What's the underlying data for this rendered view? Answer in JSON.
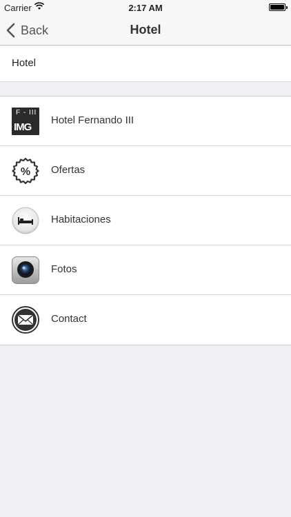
{
  "status_bar": {
    "carrier": "Carrier",
    "time": "2:17 AM"
  },
  "nav": {
    "back_label": "Back",
    "title": "Hotel"
  },
  "header_row": {
    "text": "Hotel"
  },
  "menu": {
    "items": [
      {
        "label": "Hotel Fernando III",
        "icon": "hotel-logo-icon"
      },
      {
        "label": "Ofertas",
        "icon": "percent-badge-icon"
      },
      {
        "label": "Habitaciones",
        "icon": "bed-icon"
      },
      {
        "label": "Fotos",
        "icon": "camera-icon"
      },
      {
        "label": "Contact",
        "icon": "mail-icon"
      }
    ],
    "logo_text_top": "F - III",
    "logo_text_bottom": "IMG"
  }
}
